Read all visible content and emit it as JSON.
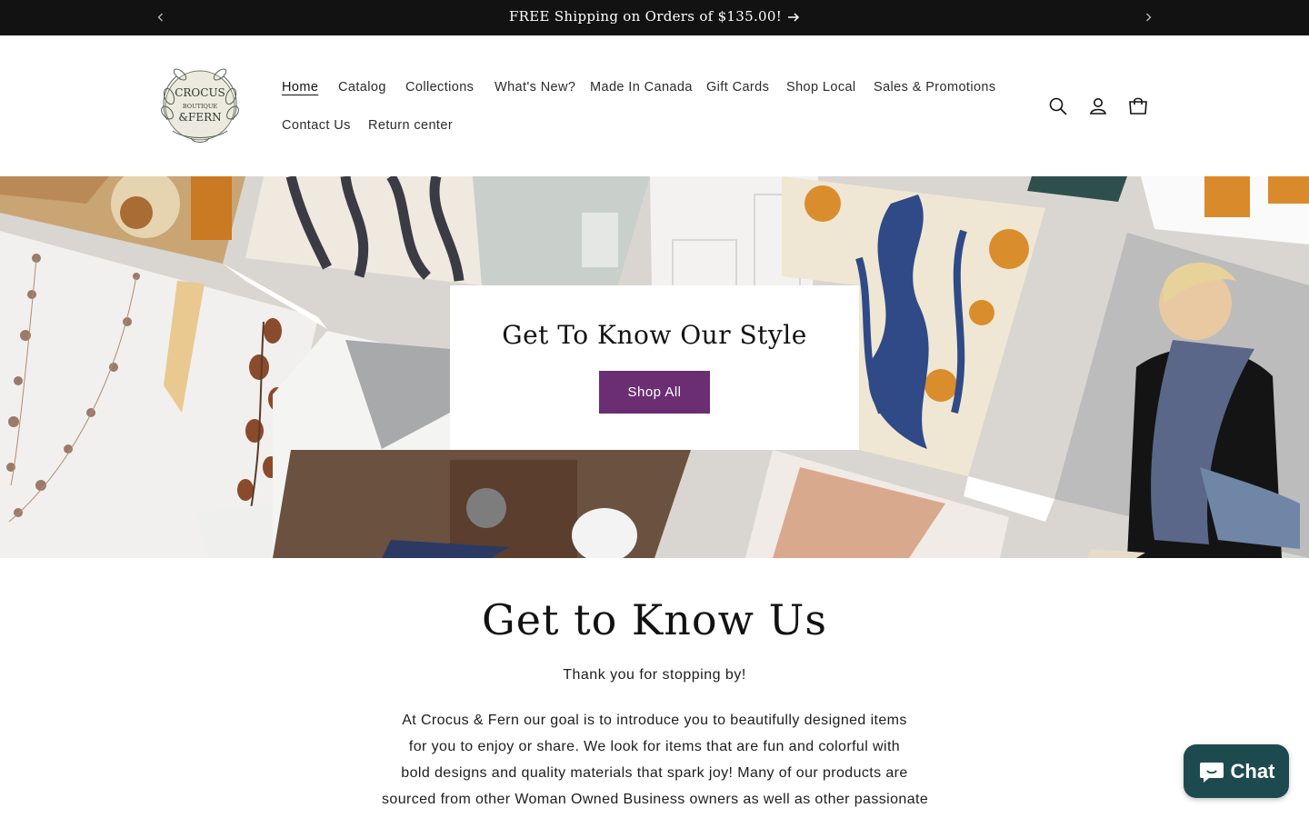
{
  "announcement": {
    "message": "FREE Shipping on Orders of $135.00!",
    "prev_icon": "chevron-left-icon",
    "next_icon": "chevron-right-icon"
  },
  "header": {
    "logo": {
      "line1": "CROCUS",
      "line2": "BOUTIQUE",
      "line3": "&FERN"
    },
    "nav": [
      {
        "label": "Home",
        "active": true
      },
      {
        "label": "Catalog"
      },
      {
        "label": "Collections"
      },
      {
        "label": "What's New?"
      },
      {
        "label": "Made In Canada"
      },
      {
        "label": "Gift Cards"
      },
      {
        "label": "Shop Local"
      },
      {
        "label": "Sales & Promotions"
      },
      {
        "label": "Contact Us"
      },
      {
        "label": "Return center"
      }
    ],
    "icons": [
      "search-icon",
      "account-icon",
      "cart-icon"
    ]
  },
  "hero": {
    "title": "Get To Know Our Style",
    "button_label": "Shop All"
  },
  "about": {
    "title": "Get to Know Us",
    "intro": "Thank you for stopping by!",
    "lines": [
      "At Crocus & Fern our goal is to introduce you to beautifully designed items",
      "for you to enjoy or share. We look for items that are fun and colorful with",
      "bold designs and quality materials that spark joy! Many of our products are",
      "sourced from other Woman Owned Business owners as well as other passionate"
    ]
  },
  "chat": {
    "label": "Chat"
  },
  "colors": {
    "accent": "#6b2e73",
    "announcement_bg": "#121212",
    "chat_bg": "#1d4a4f"
  }
}
